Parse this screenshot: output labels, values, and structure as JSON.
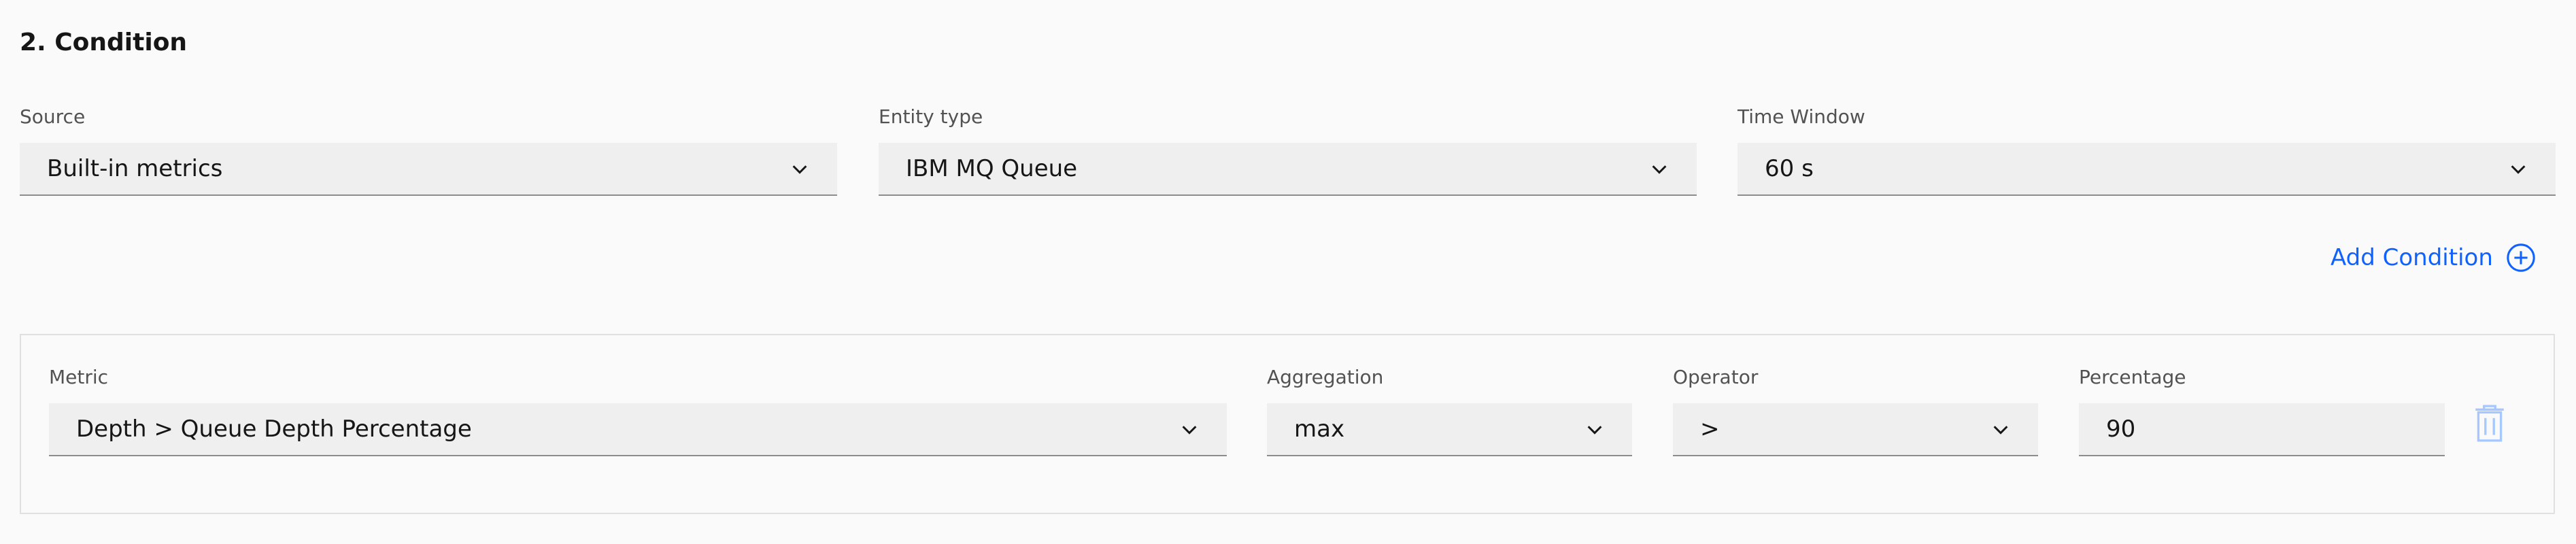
{
  "section": {
    "title": "2. Condition"
  },
  "top_fields": {
    "source": {
      "label": "Source",
      "value": "Built-in metrics"
    },
    "entity_type": {
      "label": "Entity type",
      "value": "IBM MQ Queue"
    },
    "time_window": {
      "label": "Time Window",
      "value": "60 s"
    }
  },
  "add_condition": {
    "label": "Add Condition",
    "icon": "add-circle-icon"
  },
  "condition": {
    "metric": {
      "label": "Metric",
      "value": "Depth > Queue Depth Percentage"
    },
    "aggregation": {
      "label": "Aggregation",
      "value": "max"
    },
    "operator": {
      "label": "Operator",
      "value": ">"
    },
    "percentage": {
      "label": "Percentage",
      "value": "90"
    },
    "delete_icon": "trash-icon"
  },
  "colors": {
    "accent": "#0f62fe",
    "field_bg": "#efefef",
    "field_border": "#8d8d8d",
    "label": "#525252",
    "trash_disabled": "#a6c8ff"
  }
}
